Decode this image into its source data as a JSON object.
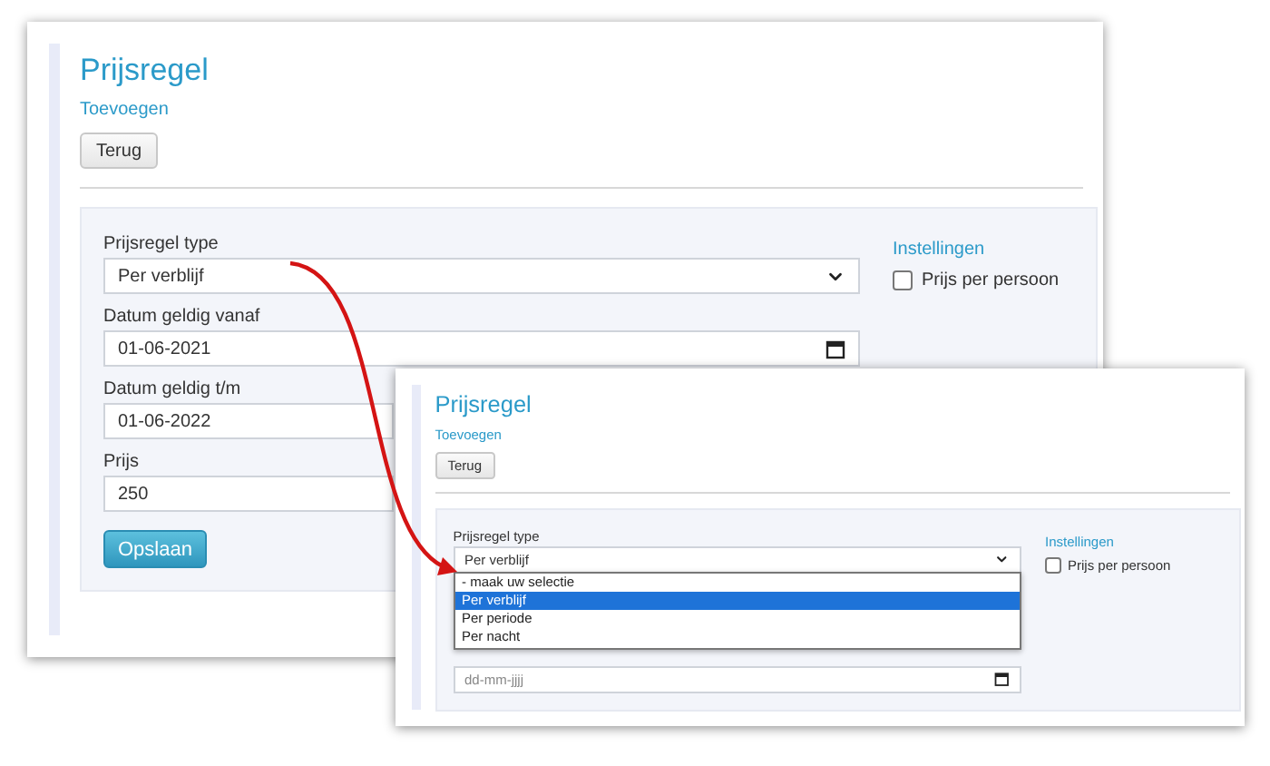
{
  "windows": [
    {
      "title": "Prijsregel",
      "subtitle": "Toevoegen",
      "back_button": "Terug",
      "fields": [
        {
          "kind": "select",
          "label": "Prijsregel type",
          "value": "Per verblijf"
        },
        {
          "kind": "date",
          "label": "Datum geldig vanaf",
          "value": "01-06-2021"
        },
        {
          "kind": "text",
          "label": "Datum geldig t/m",
          "value": "01-06-2022"
        },
        {
          "kind": "text",
          "label": "Prijs",
          "value": "250"
        }
      ],
      "save_button": "Opslaan",
      "settings": {
        "heading": "Instellingen",
        "options": [
          {
            "label": "Prijs per persoon",
            "checked": false
          }
        ]
      }
    },
    {
      "title": "Prijsregel",
      "subtitle": "Toevoegen",
      "back_button": "Terug",
      "fields": [
        {
          "kind": "select",
          "label": "Prijsregel type",
          "value": "Per verblijf",
          "dropdown": [
            {
              "label": "- maak uw selectie",
              "selected": false
            },
            {
              "label": "Per verblijf",
              "selected": true
            },
            {
              "label": "Per periode",
              "selected": false
            },
            {
              "label": "Per nacht",
              "selected": false
            }
          ]
        },
        {
          "kind": "date",
          "placeholder": "dd-mm-jjjj"
        }
      ],
      "settings": {
        "heading": "Instellingen",
        "options": [
          {
            "label": "Prijs per persoon",
            "checked": false
          }
        ]
      }
    }
  ]
}
